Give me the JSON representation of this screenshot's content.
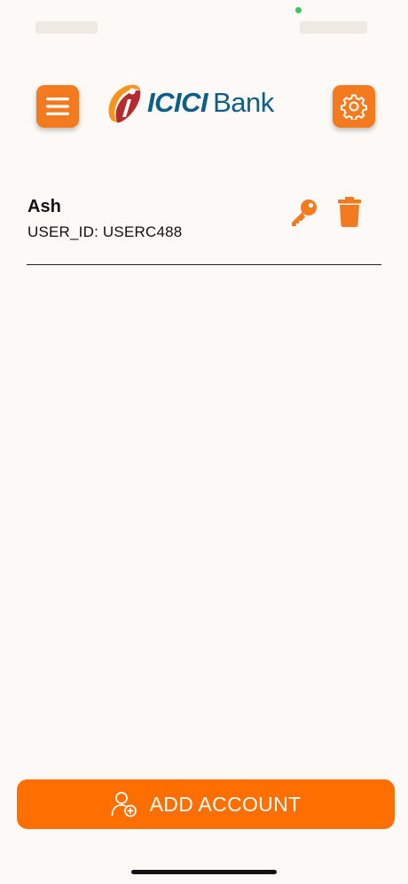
{
  "header": {
    "logo_brand": "ICICI",
    "logo_suffix": "Bank"
  },
  "accounts": [
    {
      "name": "Ash",
      "user_id": "USER_ID: USERC488"
    }
  ],
  "footer": {
    "add_account_label": "ADD ACCOUNT"
  },
  "colors": {
    "accent": "#f47a20",
    "button": "#ff6f00",
    "logo_blue": "#0d5f86",
    "logo_red": "#b52b2f",
    "background": "#fdf9f6"
  },
  "icons": {
    "menu": "hamburger-icon",
    "settings": "gear-icon",
    "key": "key-icon",
    "delete": "trash-icon",
    "add_account": "add-user-icon"
  }
}
